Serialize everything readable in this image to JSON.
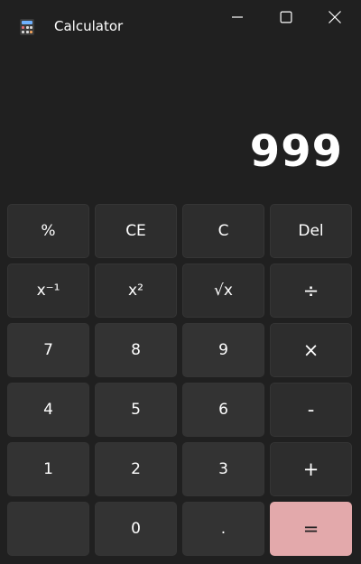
{
  "window": {
    "title": "Calculator",
    "icon": "calculator-icon",
    "controls": [
      "minimize-icon",
      "maximize-icon",
      "close-icon"
    ]
  },
  "display": {
    "value": "999"
  },
  "keys": {
    "percent": "%",
    "clear_entry": "CE",
    "clear": "C",
    "delete": "Del",
    "reciprocal": "x⁻¹",
    "square": "x²",
    "sqrt": "√x",
    "divide": "÷",
    "seven": "7",
    "eight": "8",
    "nine": "9",
    "multiply": "×",
    "four": "4",
    "five": "5",
    "six": "6",
    "subtract": "-",
    "one": "1",
    "two": "2",
    "three": "3",
    "add": "+",
    "blank": "",
    "zero": "0",
    "decimal": ".",
    "equals": "="
  },
  "colors": {
    "background": "#202020",
    "key": "#2d2d2d",
    "number_key": "#333333",
    "accent": "#e3a9ab"
  }
}
